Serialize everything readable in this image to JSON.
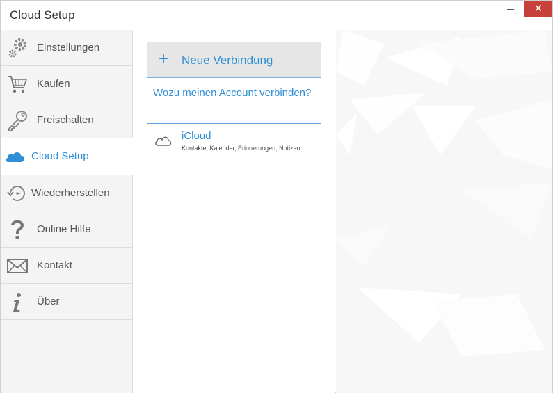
{
  "window": {
    "title": "Cloud Setup",
    "minimize_label": "",
    "close_label": "✕"
  },
  "sidebar": {
    "items": [
      {
        "label": "Einstellungen",
        "icon": "gear-icon",
        "active": false
      },
      {
        "label": "Kaufen",
        "icon": "cart-icon",
        "active": false
      },
      {
        "label": "Freischalten",
        "icon": "key-icon",
        "active": false
      },
      {
        "label": "Cloud Setup",
        "icon": "cloud-icon",
        "active": true
      },
      {
        "label": "Wiederherstellen",
        "icon": "restore-icon",
        "active": false
      },
      {
        "label": "Online Hilfe",
        "icon": "question-icon",
        "active": false
      },
      {
        "label": "Kontakt",
        "icon": "envelope-icon",
        "active": false
      },
      {
        "label": "Über",
        "icon": "info-icon",
        "active": false
      }
    ]
  },
  "main": {
    "new_connection_label": "Neue Verbindung",
    "new_connection_plus": "+",
    "why_link": "Wozu meinen Account verbinden?",
    "account": {
      "name": "iCloud",
      "description": "Kontakte, Kalender, Erinnerungen, Notizen"
    }
  },
  "colors": {
    "accent": "#2f8fd6",
    "close_button": "#c7403a",
    "sidebar_bg": "#f4f4f4"
  }
}
